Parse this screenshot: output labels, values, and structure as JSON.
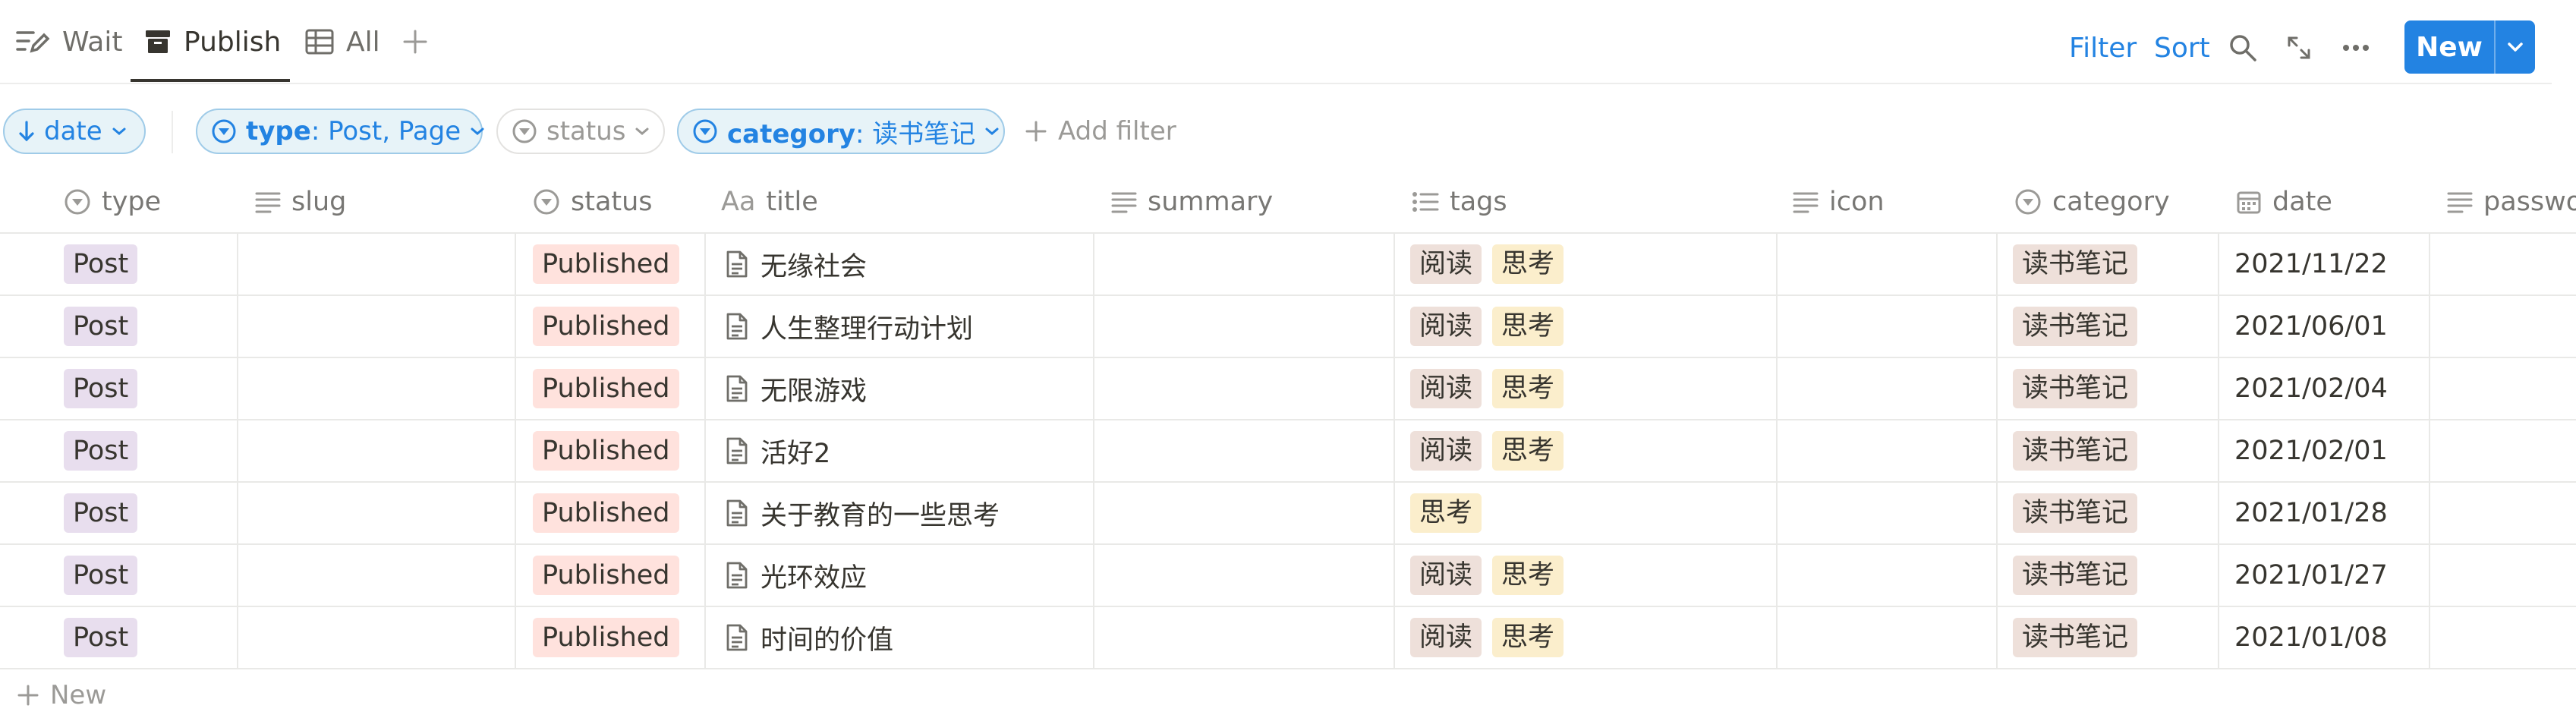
{
  "tabs": [
    {
      "label": "Wait",
      "icon": "edit-list-icon"
    },
    {
      "label": "Publish",
      "icon": "archive-box-icon",
      "active": true
    },
    {
      "label": "All",
      "icon": "table-icon"
    }
  ],
  "toolbar": {
    "filter_label": "Filter",
    "sort_label": "Sort",
    "new_label": "New"
  },
  "filters": {
    "sort": {
      "label": "date"
    },
    "type": {
      "prop": "type",
      "value": ": Post, Page"
    },
    "status": {
      "label": "status"
    },
    "category": {
      "prop": "category",
      "value": ": 读书笔记"
    },
    "add_label": "Add filter"
  },
  "columns": {
    "type": "type",
    "slug": "slug",
    "status": "status",
    "title": "title",
    "title_prefix": "Aa",
    "summary": "summary",
    "tags": "tags",
    "icon": "icon",
    "category": "category",
    "date": "date",
    "password": "passwo"
  },
  "rows": [
    {
      "type": "Post",
      "status": "Published",
      "title": "无缘社会",
      "tags": [
        "阅读",
        "思考"
      ],
      "category": "读书笔记",
      "date": "2021/11/22"
    },
    {
      "type": "Post",
      "status": "Published",
      "title": "人生整理行动计划",
      "tags": [
        "阅读",
        "思考"
      ],
      "category": "读书笔记",
      "date": "2021/06/01"
    },
    {
      "type": "Post",
      "status": "Published",
      "title": "无限游戏",
      "tags": [
        "阅读",
        "思考"
      ],
      "category": "读书笔记",
      "date": "2021/02/04"
    },
    {
      "type": "Post",
      "status": "Published",
      "title": "活好2",
      "tags": [
        "阅读",
        "思考"
      ],
      "category": "读书笔记",
      "date": "2021/02/01"
    },
    {
      "type": "Post",
      "status": "Published",
      "title": "关于教育的一些思考",
      "tags": [
        "思考"
      ],
      "category": "读书笔记",
      "date": "2021/01/28"
    },
    {
      "type": "Post",
      "status": "Published",
      "title": "光环效应",
      "tags": [
        "阅读",
        "思考"
      ],
      "category": "读书笔记",
      "date": "2021/01/27"
    },
    {
      "type": "Post",
      "status": "Published",
      "title": "时间的价值",
      "tags": [
        "阅读",
        "思考"
      ],
      "category": "读书笔记",
      "date": "2021/01/08"
    }
  ],
  "new_row_label": "New",
  "colors": {
    "accent": "#2383e2",
    "type_post_bg": "#e8deee",
    "status_published_bg": "#ffe2dd",
    "tag_read_bg": "#eee0da",
    "tag_think_bg": "#fbeecc",
    "category_bg": "#eee0da"
  }
}
